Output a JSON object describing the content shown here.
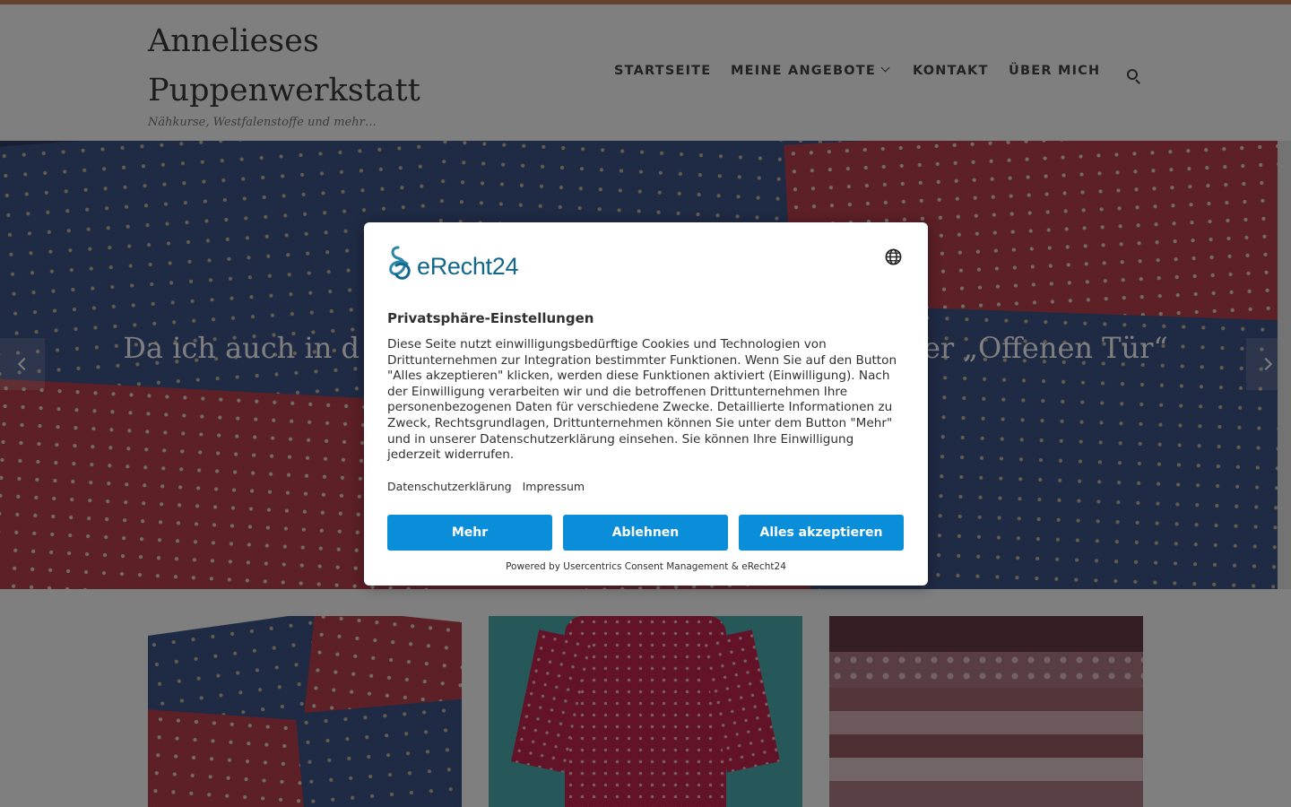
{
  "site": {
    "title": "Annelieses Puppenwerkstatt",
    "tagline": "Nähkurse, Westfalenstoffe und mehr…"
  },
  "nav": {
    "items": [
      "STARTSEITE",
      "MEINE ANGEBOTE",
      "KONTAKT",
      "ÜBER MICH"
    ],
    "search_icon": "search-icon"
  },
  "hero": {
    "caption_left": "Da ich auch in d",
    "caption_right": "er „Offenen Tür“"
  },
  "colors": {
    "accent": "#c9895b",
    "button": "#0a8ed9",
    "logo": "#12688a"
  },
  "consent": {
    "logo_text": "eRecht24",
    "title": "Privatsphäre-Einstellungen",
    "body": "Diese Seite nutzt einwilligungsbedürftige Cookies und Technologien von Drittunternehmen zur Integration bestimmter Funktionen. Wenn Sie auf den Button \"Alles akzeptieren\" klicken, werden diese Funktionen aktiviert (Einwilligung). Nach der Einwilligung verarbeiten wir und die betroffenen Drittunternehmen Ihre personenbezogenen Daten für verschiedene Zwecke. Detaillierte Informationen zu Zweck, Rechtsgrundlagen, Drittunternehmen können Sie unter dem Button \"Mehr\" und in unserer Datenschutzerklärung einsehen. Sie können Ihre Einwilligung jederzeit widerrufen.",
    "links": [
      "Datenschutzerklärung",
      "Impressum"
    ],
    "buttons": {
      "more": "Mehr",
      "deny": "Ablehnen",
      "accept": "Alles akzeptieren"
    },
    "powered_by": "Powered by Usercentrics Consent Management & eRecht24"
  }
}
